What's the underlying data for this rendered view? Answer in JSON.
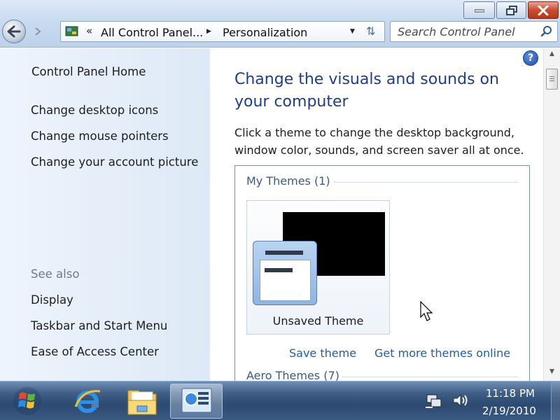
{
  "address": {
    "crumb_root": "All Control Panel...",
    "crumb_current": "Personalization",
    "chevrons": "«"
  },
  "search": {
    "placeholder": "Search Control Panel"
  },
  "sidebar": {
    "home": "Control Panel Home",
    "tasks": [
      "Change desktop icons",
      "Change mouse pointers",
      "Change your account picture"
    ],
    "see_also_label": "See also",
    "see_also": [
      "Display",
      "Taskbar and Start Menu",
      "Ease of Access Center"
    ]
  },
  "main": {
    "title": "Change the visuals and sounds on your computer",
    "description": "Click a theme to change the desktop background, window color, sounds, and screen saver all at once.",
    "help": "?",
    "my_themes_header": "My Themes (1)",
    "themes": [
      {
        "name": "Unsaved Theme"
      }
    ],
    "save_theme": "Save theme",
    "get_more_themes": "Get more themes online",
    "aero_themes_header": "Aero Themes (7)"
  },
  "taskbar": {
    "clock_time": "11:18 PM",
    "clock_date": "2/19/2010",
    "items": [
      "start-orb-icon",
      "internet-explorer-icon",
      "windows-explorer-icon",
      "personalization-icon"
    ]
  },
  "colors": {
    "accent_title": "#1e3d8f",
    "link": "#1f5fa8",
    "sidebar_bg": "#dde9f6",
    "taskbar_bg": "#2d4a70"
  }
}
